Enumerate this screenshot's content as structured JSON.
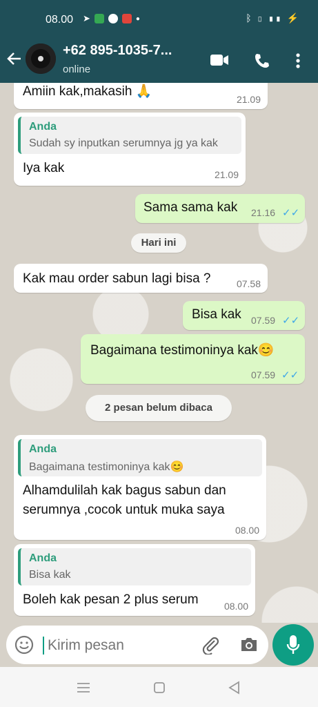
{
  "status_bar": {
    "time": "08.00",
    "right_icons": "ᛒ ▯ ▮▮ ⚡"
  },
  "header": {
    "contact": "+62 895-1035-7...",
    "presence": "online"
  },
  "messages": [
    {
      "text": "Amiin kak,makasih 🙏",
      "time": "21.09"
    },
    {
      "quote_name": "Anda",
      "quote_text": "Sudah sy inputkan serumnya jg ya kak",
      "text": "Iya kak",
      "time": "21.09"
    },
    {
      "text": "Sama sama kak",
      "time": "21.16",
      "ticks": "✓✓"
    },
    {
      "pill": "Hari ini"
    },
    {
      "text": "Kak mau order sabun lagi bisa ?",
      "time": "07.58"
    },
    {
      "text": "Bisa kak",
      "time": "07.59",
      "ticks": "✓✓"
    },
    {
      "text": "Bagaimana testimoninya kak😊",
      "time": "07.59",
      "ticks": "✓✓"
    },
    {
      "pill": "2 pesan belum dibaca"
    },
    {
      "quote_name": "Anda",
      "quote_text": "Bagaimana testimoninya kak😊",
      "text_line1": "Alhamdulilah kak bagus sabun dan",
      "text_line2": "serumnya ,cocok untuk muka saya",
      "time": "08.00"
    },
    {
      "quote_name": "Anda",
      "quote_text": "Bisa kak",
      "text": "Boleh kak pesan 2 plus serum",
      "time": "08.00"
    }
  ],
  "input": {
    "placeholder": "Kirim pesan"
  },
  "colors": {
    "header": "#1f4f58",
    "outgoing": "#dcf8c6",
    "accent": "#0e9e84",
    "tick": "#3ea7e8"
  },
  "icons": [
    "back-arrow-icon",
    "video-call-icon",
    "phone-icon",
    "more-vert-icon",
    "emoji-icon",
    "attach-icon",
    "camera-icon",
    "mic-icon",
    "nav-menu-icon",
    "nav-home-icon",
    "nav-back-icon"
  ]
}
